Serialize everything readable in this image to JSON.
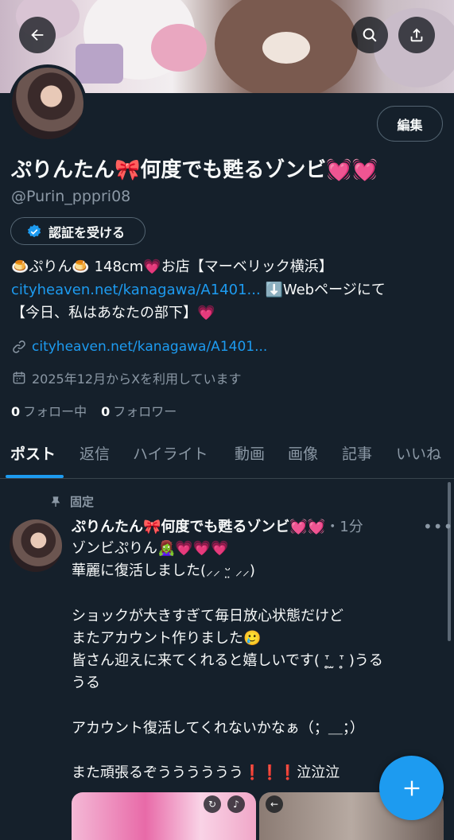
{
  "header": {
    "back_icon": "arrow-left-icon",
    "search_icon": "search-icon",
    "share_icon": "share-icon"
  },
  "profile": {
    "edit_label": "編集",
    "display_name": "ぷりんたん🎀何度でも甦るゾンビ💓💓",
    "handle": "@Purin_pppri08",
    "verify_label": "認証を受ける",
    "bio_line1": "🍮ぷりん🍮 148cm💗お店【マーベリック横浜】",
    "bio_link": "cityheaven.net/kanagawa/A1401...",
    "bio_line2_rest": " ⬇️Webページにて",
    "bio_line3": "【今日、私はあなたの部下】💗",
    "website": "cityheaven.net/kanagawa/A1401...",
    "joined": "2025年12月からXを利用しています",
    "following_count": "0",
    "following_label": "フォロー中",
    "followers_count": "0",
    "followers_label": "フォロワー"
  },
  "tabs": [
    {
      "label": "ポスト"
    },
    {
      "label": "返信"
    },
    {
      "label": "ハイライト"
    },
    {
      "label": "動画"
    },
    {
      "label": "画像"
    },
    {
      "label": "記事"
    },
    {
      "label": "いいね"
    }
  ],
  "post": {
    "pinned_label": "固定",
    "author": "ぷりんたん🎀何度でも甦るゾンビ💓💓",
    "time": "・1分",
    "lines": [
      "ゾンビぷりん🧟‍♀️💗💗💗",
      "華麗に復活しました(⸝⸝ ᵕ̤ ⸝⸝)",
      "",
      "ショックが大きすぎて毎日放心状態だけど",
      "またアカウント作りました🥲",
      "皆さん迎えに来てくれると嬉しいです( ᐪ̥ ̫ ᐪ̥ )うる",
      "うる",
      "",
      "アカウント復活してくれないかなぁ（；＿；）",
      "",
      "また頑張るぞうううううう❗️❗️❗️泣泣泣"
    ]
  },
  "colors": {
    "background": "#15202b",
    "accent": "#1d9bf0",
    "muted": "#8b98a5"
  },
  "fab_icon": "plus-icon"
}
